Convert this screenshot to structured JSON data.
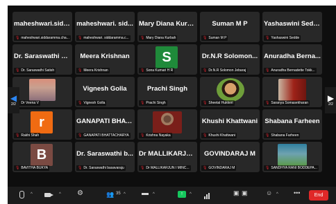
{
  "nav": {
    "left_page": "2/2",
    "right_page": "2/2"
  },
  "tiles": [
    {
      "name": "maheshwari.sidd...",
      "label": "maheshwari.siddaramma.cha...",
      "type": "name"
    },
    {
      "name": "maheshwari. sid...",
      "label": "maheshwari. siddaramma.c...",
      "type": "name"
    },
    {
      "name": "Mary Diana Kurb...",
      "label": "Mary Diana Kurbah",
      "type": "name"
    },
    {
      "name": "Suman M P",
      "label": "Suman M P",
      "type": "name"
    },
    {
      "name": "Yashaswini Sedde",
      "label": "Yashaswini Sedde",
      "type": "name"
    },
    {
      "name": "Dr. Saraswathi S...",
      "label": "Dr. Saraswathi Satish",
      "type": "name"
    },
    {
      "name": "Meera Krishnan",
      "label": "Meera Krishnan",
      "type": "name"
    },
    {
      "name": "S",
      "label": "Sona Kumari H R",
      "type": "letter",
      "color": "#1f8a3a"
    },
    {
      "name": "Dr.N.R Solomon...",
      "label": "Dr.N.R Solomon Jebaraj",
      "type": "name"
    },
    {
      "name": "Anuradha Berna...",
      "label": "Anuradha Bernadette Tokk...",
      "type": "name"
    },
    {
      "name": "",
      "label": "Dr Veena V",
      "type": "photo",
      "photo": "p-girl"
    },
    {
      "name": "Vignesh Golla",
      "label": "Vignesh Golla",
      "type": "name"
    },
    {
      "name": "Prachi Singh",
      "label": "Prachi Singh",
      "type": "name"
    },
    {
      "name": "",
      "label": "Sheetal Hukkeri",
      "type": "photo",
      "photo": "p-woman"
    },
    {
      "name": "",
      "label": "Saranya Somasekharan",
      "type": "photo",
      "photo": "p-saranya"
    },
    {
      "name": "r",
      "label": "Rakhi Shah",
      "type": "letter",
      "color": "#f06b12"
    },
    {
      "name": "GANAPATI BHAT...",
      "label": "GANAPATI BHATTACHARYA",
      "type": "name"
    },
    {
      "name": "",
      "label": "Krishna Nayaka",
      "type": "photo",
      "photo": "p-krishna"
    },
    {
      "name": "Khushi Khattwani",
      "label": "Khushi Khattwani",
      "type": "name"
    },
    {
      "name": "Shabana Farheen",
      "label": "Shabana Farheen",
      "type": "name"
    },
    {
      "name": "B",
      "label": "BAVITHA BUKYA",
      "type": "letter",
      "color": "#7a4a42"
    },
    {
      "name": "Dr. Saraswathi b...",
      "label": "Dr. Saraswathi basavaraju",
      "type": "name"
    },
    {
      "name": "Dr MALLIKARJU...",
      "label": "Dr MALLIKARJUN I MINC...",
      "type": "name"
    },
    {
      "name": "GOVINDARAJ M",
      "label": "GOVINDARAJ M",
      "type": "name"
    },
    {
      "name": "",
      "label": "SANDHYA RANI BODDEPA...",
      "type": "photo",
      "photo": "p-sandhya"
    }
  ],
  "toolbar": {
    "participants_count": "35",
    "end_label": "End"
  },
  "colors": {
    "end": "#e02828",
    "share": "#15c75d",
    "nav_arrow": "#2b86f3",
    "mic_muted": "#e0242e"
  },
  "icons": [
    "microphone-icon",
    "video-camera-icon",
    "security-shield-icon",
    "participants-icon",
    "chat-icon",
    "share-screen-icon",
    "stats-bars-icon",
    "record-icon",
    "reactions-icon",
    "more-icon"
  ]
}
